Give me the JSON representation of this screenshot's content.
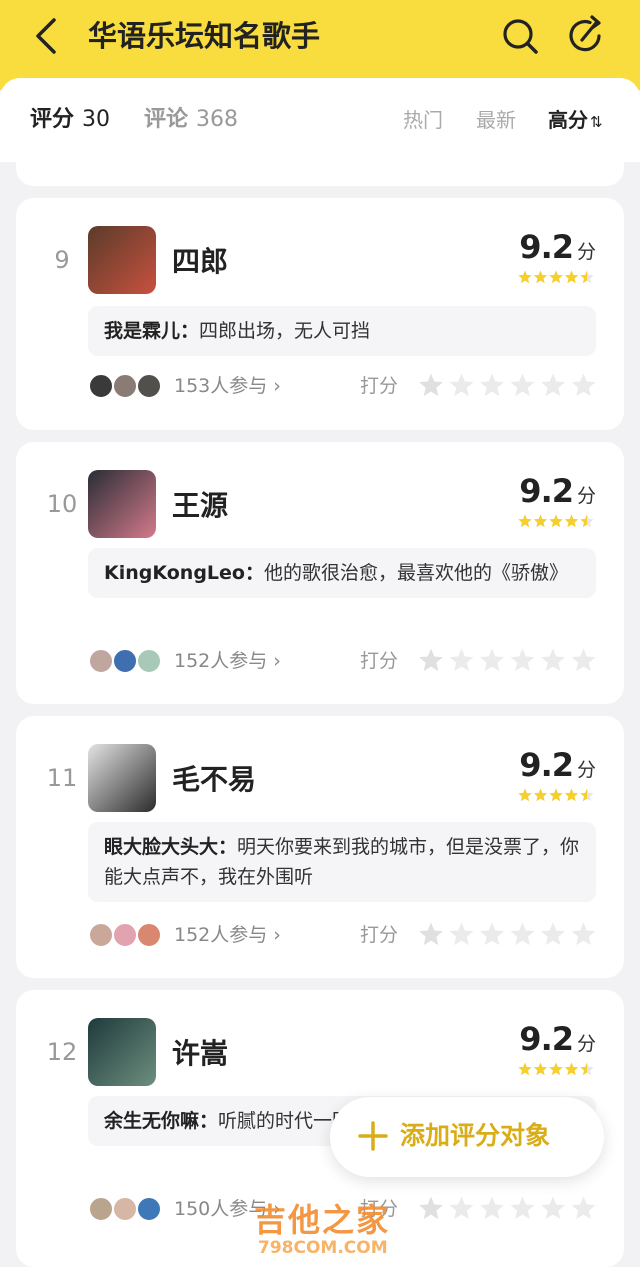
{
  "header": {
    "title": "华语乐坛知名歌手",
    "back_icon": "chevron-left-icon",
    "search_icon": "search-icon",
    "share_icon": "share-icon",
    "background": "#f9dc3d"
  },
  "tabs": {
    "rating_label": "评分",
    "rating_count": "30",
    "comment_label": "评论",
    "comment_count": "368"
  },
  "sort": {
    "hot": "热门",
    "newest": "最新",
    "highest": "高分",
    "highest_icon": "⇅"
  },
  "cards": [
    {
      "rank": "9",
      "name": "四郎",
      "score": "9.2",
      "score_unit": "分",
      "stars_filled": 4.5,
      "comment_author": "我是霖儿：",
      "comment_text": "四郎出场，无人可挡",
      "participants": "153人参与",
      "rate_label": "打分",
      "avatar_colors": [
        "#5b3b2a",
        "#c8513f"
      ],
      "participant_colors": [
        "#3a3a3a",
        "#8a7b74",
        "#52504c"
      ]
    },
    {
      "rank": "10",
      "name": "王源",
      "score": "9.2",
      "score_unit": "分",
      "stars_filled": 4.5,
      "comment_author": "KingKongLeo：",
      "comment_text": "他的歌很治愈，最喜欢他的《骄傲》",
      "participants": "152人参与",
      "rate_label": "打分",
      "avatar_colors": [
        "#2a2d36",
        "#d47a8a"
      ],
      "participant_colors": [
        "#bfa7a0",
        "#3f6fb0",
        "#a9c9b8"
      ]
    },
    {
      "rank": "11",
      "name": "毛不易",
      "score": "9.2",
      "score_unit": "分",
      "stars_filled": 4.5,
      "comment_author": "眼大脸大头大：",
      "comment_text": "明天你要来到我的城市，但是没票了，你能大点声不，我在外围听",
      "participants": "152人参与",
      "rate_label": "打分",
      "avatar_colors": [
        "#e4e4e4",
        "#2b2b2b"
      ],
      "participant_colors": [
        "#c9a89a",
        "#e2a3b0",
        "#d9876e"
      ]
    },
    {
      "rank": "12",
      "name": "许嵩",
      "score": "9.2",
      "score_unit": "分",
      "stars_filled": 4.5,
      "comment_author": "余生无你嘛：",
      "comment_text": "听腻的时代一回头就又会爱上。许嵩",
      "participants": "150人参与",
      "rate_label": "打分",
      "avatar_colors": [
        "#1f3a3c",
        "#6d8f7e"
      ],
      "participant_colors": [
        "#b9a48e",
        "#d6b7a5",
        "#3f78b8"
      ]
    }
  ],
  "fab": {
    "label": "添加评分对象",
    "icon": "plus-icon",
    "color": "#d9ad18"
  },
  "watermark": {
    "main": "吉他之家",
    "sub": "798COM.COM"
  },
  "colors": {
    "star_filled": "#f5cf2b",
    "star_empty": "#e6e6e6"
  }
}
